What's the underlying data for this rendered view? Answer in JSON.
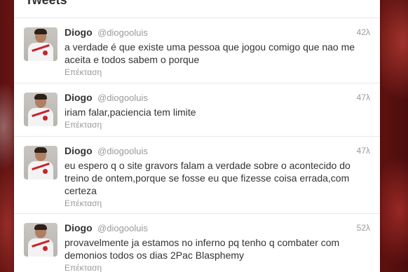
{
  "stream": {
    "title": "Tweets"
  },
  "tweets": [
    {
      "fullname": "Diogo",
      "username": "@diogooluis",
      "time": "42λ",
      "text": "a verdade é que existe uma pessoa que jogou comigo que nao me aceita e todos sabem o porque",
      "expand": "Επέκταση"
    },
    {
      "fullname": "Diogo",
      "username": "@diogooluis",
      "time": "47λ",
      "text": "iriam falar,paciencia tem limite",
      "expand": "Επέκταση"
    },
    {
      "fullname": "Diogo",
      "username": "@diogooluis",
      "time": "47λ",
      "text": "eu espero q o site gravors falam a verdade sobre o acontecido do treino de ontem,porque se fosse eu que fizesse coisa errada,com certeza",
      "expand": "Επέκταση"
    },
    {
      "fullname": "Diogo",
      "username": "@diogooluis",
      "time": "52λ",
      "text": "provavelmente ja estamos no inferno pq tenho q combater com demonios todos os dias 2Pac Blasphemy",
      "expand": "Επέκταση"
    }
  ]
}
